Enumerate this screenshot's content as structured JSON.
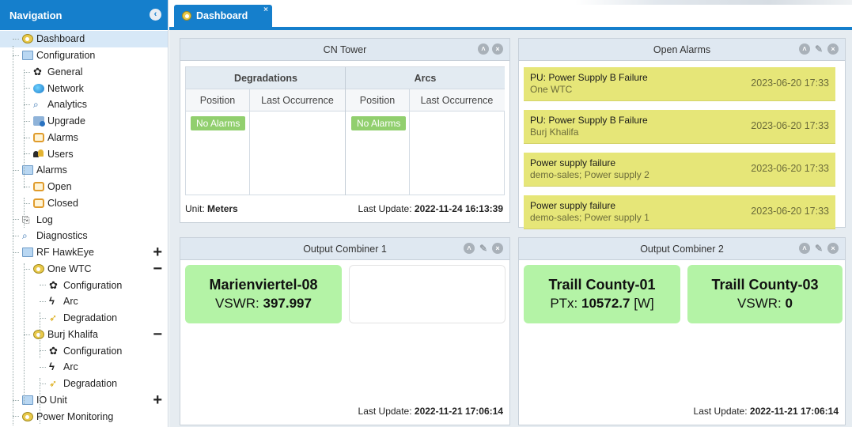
{
  "nav": {
    "title": "Navigation",
    "items": [
      {
        "label": "Dashboard",
        "icon": "eye-icon"
      },
      {
        "label": "Configuration",
        "icon": "folder-icon"
      },
      {
        "label": "General",
        "icon": "gear-icon"
      },
      {
        "label": "Network",
        "icon": "globe-icon"
      },
      {
        "label": "Analytics",
        "icon": "magnifier-icon"
      },
      {
        "label": "Upgrade",
        "icon": "upgrade-icon"
      },
      {
        "label": "Alarms",
        "icon": "alarm-icon"
      },
      {
        "label": "Users",
        "icon": "users-icon"
      },
      {
        "label": "Alarms",
        "icon": "folder-icon"
      },
      {
        "label": "Open",
        "icon": "alarm-icon"
      },
      {
        "label": "Closed",
        "icon": "alarm-icon"
      },
      {
        "label": "Log",
        "icon": "log-icon"
      },
      {
        "label": "Diagnostics",
        "icon": "magnifier-icon"
      },
      {
        "label": "RF HawkEye",
        "icon": "folder-icon",
        "toggle": "+"
      },
      {
        "label": "One WTC",
        "icon": "eye-icon",
        "toggle": "−"
      },
      {
        "label": "Configuration",
        "icon": "gear-icon"
      },
      {
        "label": "Arc",
        "icon": "arc-icon"
      },
      {
        "label": "Degradation",
        "icon": "degradation-icon"
      },
      {
        "label": "Burj Khalifa",
        "icon": "eye-icon",
        "toggle": "−"
      },
      {
        "label": "Configuration",
        "icon": "gear-icon"
      },
      {
        "label": "Arc",
        "icon": "arc-icon"
      },
      {
        "label": "Degradation",
        "icon": "degradation-icon"
      },
      {
        "label": "IO Unit",
        "icon": "folder-icon",
        "toggle": "+"
      },
      {
        "label": "Power Monitoring",
        "icon": "eye-icon"
      }
    ]
  },
  "tabs": [
    {
      "label": "Dashboard",
      "close": "×"
    }
  ],
  "colors": {
    "accent": "#157fcc",
    "alarm_bg": "#e6e678",
    "ok_green": "#b4f3a6",
    "no_alarm_green": "#91cf6e"
  },
  "cn_tower": {
    "title": "CN Tower",
    "groups": [
      "Degradations",
      "Arcs"
    ],
    "columns": [
      "Position",
      "Last Occurrence",
      "Position",
      "Last Occurrence"
    ],
    "no_alarms": "No Alarms",
    "unit_label": "Unit:",
    "unit_value": "Meters",
    "update_label": "Last Update:",
    "update_value": "2022-11-24 16:13:39"
  },
  "open_alarms": {
    "title": "Open Alarms",
    "items": [
      {
        "title": "PU: Power Supply B Failure",
        "sub": "One WTC",
        "time": "2023-06-20 17:33"
      },
      {
        "title": "PU: Power Supply B Failure",
        "sub": "Burj Khalifa",
        "time": "2023-06-20 17:33"
      },
      {
        "title": "Power supply failure",
        "sub": "demo-sales; Power supply 2",
        "time": "2023-06-20 17:33"
      },
      {
        "title": "Power supply failure",
        "sub": "demo-sales; Power supply 1",
        "time": "2023-06-20 17:33"
      }
    ]
  },
  "combiner1": {
    "title": "Output Combiner 1",
    "cards": [
      {
        "name": "Marienviertel-08",
        "metric": "VSWR:",
        "value": "397.997",
        "unit": ""
      }
    ],
    "update_label": "Last Update:",
    "update_value": "2022-11-21 17:06:14"
  },
  "combiner2": {
    "title": "Output Combiner 2",
    "cards": [
      {
        "name": "Traill County-01",
        "metric": "PTx:",
        "value": "10572.7",
        "unit": "[W]"
      },
      {
        "name": "Traill County-03",
        "metric": "VSWR:",
        "value": "0",
        "unit": ""
      }
    ],
    "update_label": "Last Update:",
    "update_value": "2022-11-21 17:06:14"
  }
}
